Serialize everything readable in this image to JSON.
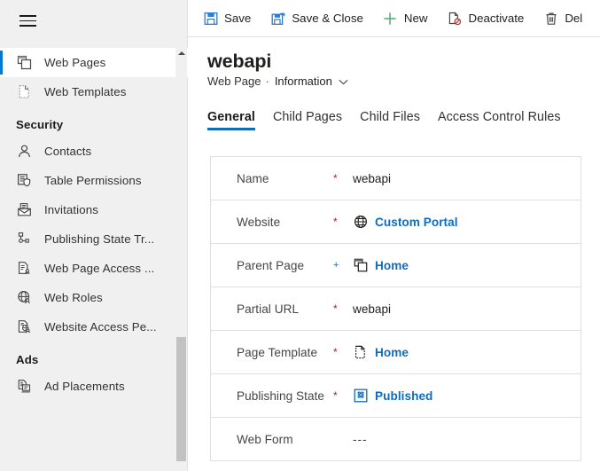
{
  "sidebar": {
    "menu_icon": "hamburger-icon",
    "groups": [
      {
        "title": null,
        "items": [
          {
            "label": "Web Pages",
            "icon": "web-pages-icon",
            "selected": true
          },
          {
            "label": "Web Templates",
            "icon": "web-templates-icon",
            "selected": false
          }
        ]
      },
      {
        "title": "Security",
        "items": [
          {
            "label": "Contacts",
            "icon": "contact-icon",
            "selected": false
          },
          {
            "label": "Table  Permissions",
            "icon": "table-permissions-icon",
            "selected": false
          },
          {
            "label": "Invitations",
            "icon": "invitations-icon",
            "selected": false
          },
          {
            "label": "Publishing State Tr...",
            "icon": "publishing-state-transition-icon",
            "selected": false
          },
          {
            "label": "Web Page Access ...",
            "icon": "web-page-access-icon",
            "selected": false
          },
          {
            "label": "Web Roles",
            "icon": "web-roles-icon",
            "selected": false
          },
          {
            "label": "Website Access Pe...",
            "icon": "website-access-permission-icon",
            "selected": false
          }
        ]
      },
      {
        "title": "Ads",
        "items": [
          {
            "label": "Ad Placements",
            "icon": "ad-placements-icon",
            "selected": false
          }
        ]
      }
    ],
    "scrollbar": {
      "up_arrow": "scroll-up-arrow-icon"
    }
  },
  "commandbar": {
    "commands": [
      {
        "label": "Save",
        "icon": "save-icon"
      },
      {
        "label": "Save & Close",
        "icon": "save-and-close-icon"
      },
      {
        "label": "New",
        "icon": "plus-icon"
      },
      {
        "label": "Deactivate",
        "icon": "deactivate-icon"
      },
      {
        "label": "Del",
        "icon": "trash-icon"
      }
    ]
  },
  "record": {
    "title": "webapi",
    "entity": "Web Page",
    "separator": "·",
    "form_name": "Information",
    "chevron": "⌄"
  },
  "tabs": [
    {
      "label": "General",
      "active": true
    },
    {
      "label": "Child Pages",
      "active": false
    },
    {
      "label": "Child Files",
      "active": false
    },
    {
      "label": "Access Control Rules",
      "active": false
    }
  ],
  "form": {
    "fields": [
      {
        "label": "Name",
        "required": "*",
        "required_type": "required",
        "value": "webapi",
        "value_type": "text",
        "icon": null
      },
      {
        "label": "Website",
        "required": "*",
        "required_type": "required",
        "value": "Custom Portal",
        "value_type": "link",
        "icon": "globe-icon"
      },
      {
        "label": "Parent Page",
        "required": "+",
        "required_type": "recommended",
        "value": "Home",
        "value_type": "link",
        "icon": "web-pages-icon"
      },
      {
        "label": "Partial URL",
        "required": "*",
        "required_type": "required",
        "value": "webapi",
        "value_type": "text",
        "icon": null
      },
      {
        "label": "Page Template",
        "required": "*",
        "required_type": "required",
        "value": "Home",
        "value_type": "link",
        "icon": "page-template-icon"
      },
      {
        "label": "Publishing State",
        "required": "*",
        "required_type": "required",
        "value": "Published",
        "value_type": "link",
        "icon": "publishing-state-icon"
      },
      {
        "label": "Web Form",
        "required": "",
        "required_type": "none",
        "value": "---",
        "value_type": "empty",
        "icon": null
      }
    ]
  },
  "colors": {
    "accent": "#0f6cbd",
    "link": "#0f6cbd",
    "required": "#a4262c",
    "sidebar_bg": "#f0f0f0",
    "border": "#e1dfdd",
    "new_icon": "#57a773",
    "save_icon": "#2b7cd3"
  }
}
